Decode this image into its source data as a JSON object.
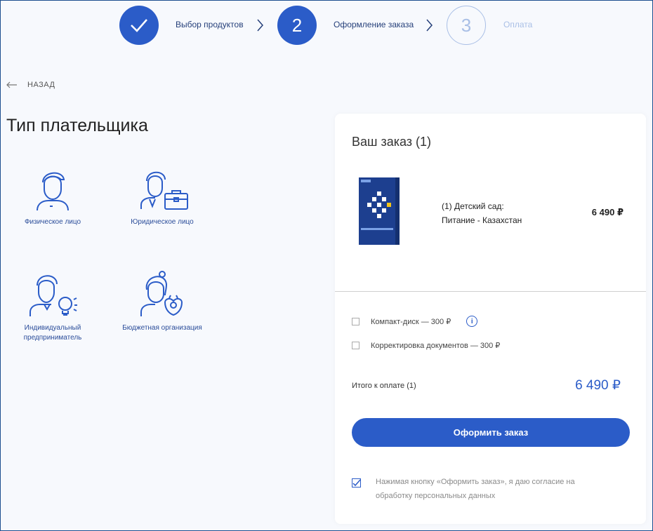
{
  "stepper": {
    "steps": [
      {
        "label": "Выбор продуктов",
        "state": "done"
      },
      {
        "number": "2",
        "label": "Оформление заказа",
        "state": "active"
      },
      {
        "number": "3",
        "label": "Оплата",
        "state": "pending"
      }
    ],
    "colors": {
      "active": "#2b5cc8",
      "pending": "#a9bfe6"
    }
  },
  "back": {
    "label": "НАЗАД",
    "icon": "arrow-left-icon"
  },
  "payer_section": {
    "title": "Тип плательщика",
    "options": [
      {
        "label": "Физическое лицо",
        "icon": "person-icon"
      },
      {
        "label": "Юридическое лицо",
        "icon": "person-briefcase-icon"
      },
      {
        "label": "Индивидуальный предприниматель",
        "icon": "person-lightbulb-icon"
      },
      {
        "label": "Бюджетная организация",
        "icon": "person-emblem-icon"
      }
    ]
  },
  "order": {
    "title": "Ваш заказ (1)",
    "item": {
      "name_line1": "(1) Детский сад:",
      "name_line2": "Питание - Казахстан",
      "price": "6 490 ₽"
    },
    "options": [
      {
        "label": "Компакт-диск — 300 ₽",
        "checked": false,
        "info_icon": "info-icon"
      },
      {
        "label": "Корректировка документов — 300 ₽",
        "checked": false
      }
    ],
    "total_label": "Итого к оплате (1)",
    "total_value": "6 490 ₽",
    "submit_label": "Оформить заказ",
    "consent": {
      "checked": true,
      "text": "Нажимая кнопку «Оформить заказ», я даю согласие на обработку персональных данных"
    }
  }
}
